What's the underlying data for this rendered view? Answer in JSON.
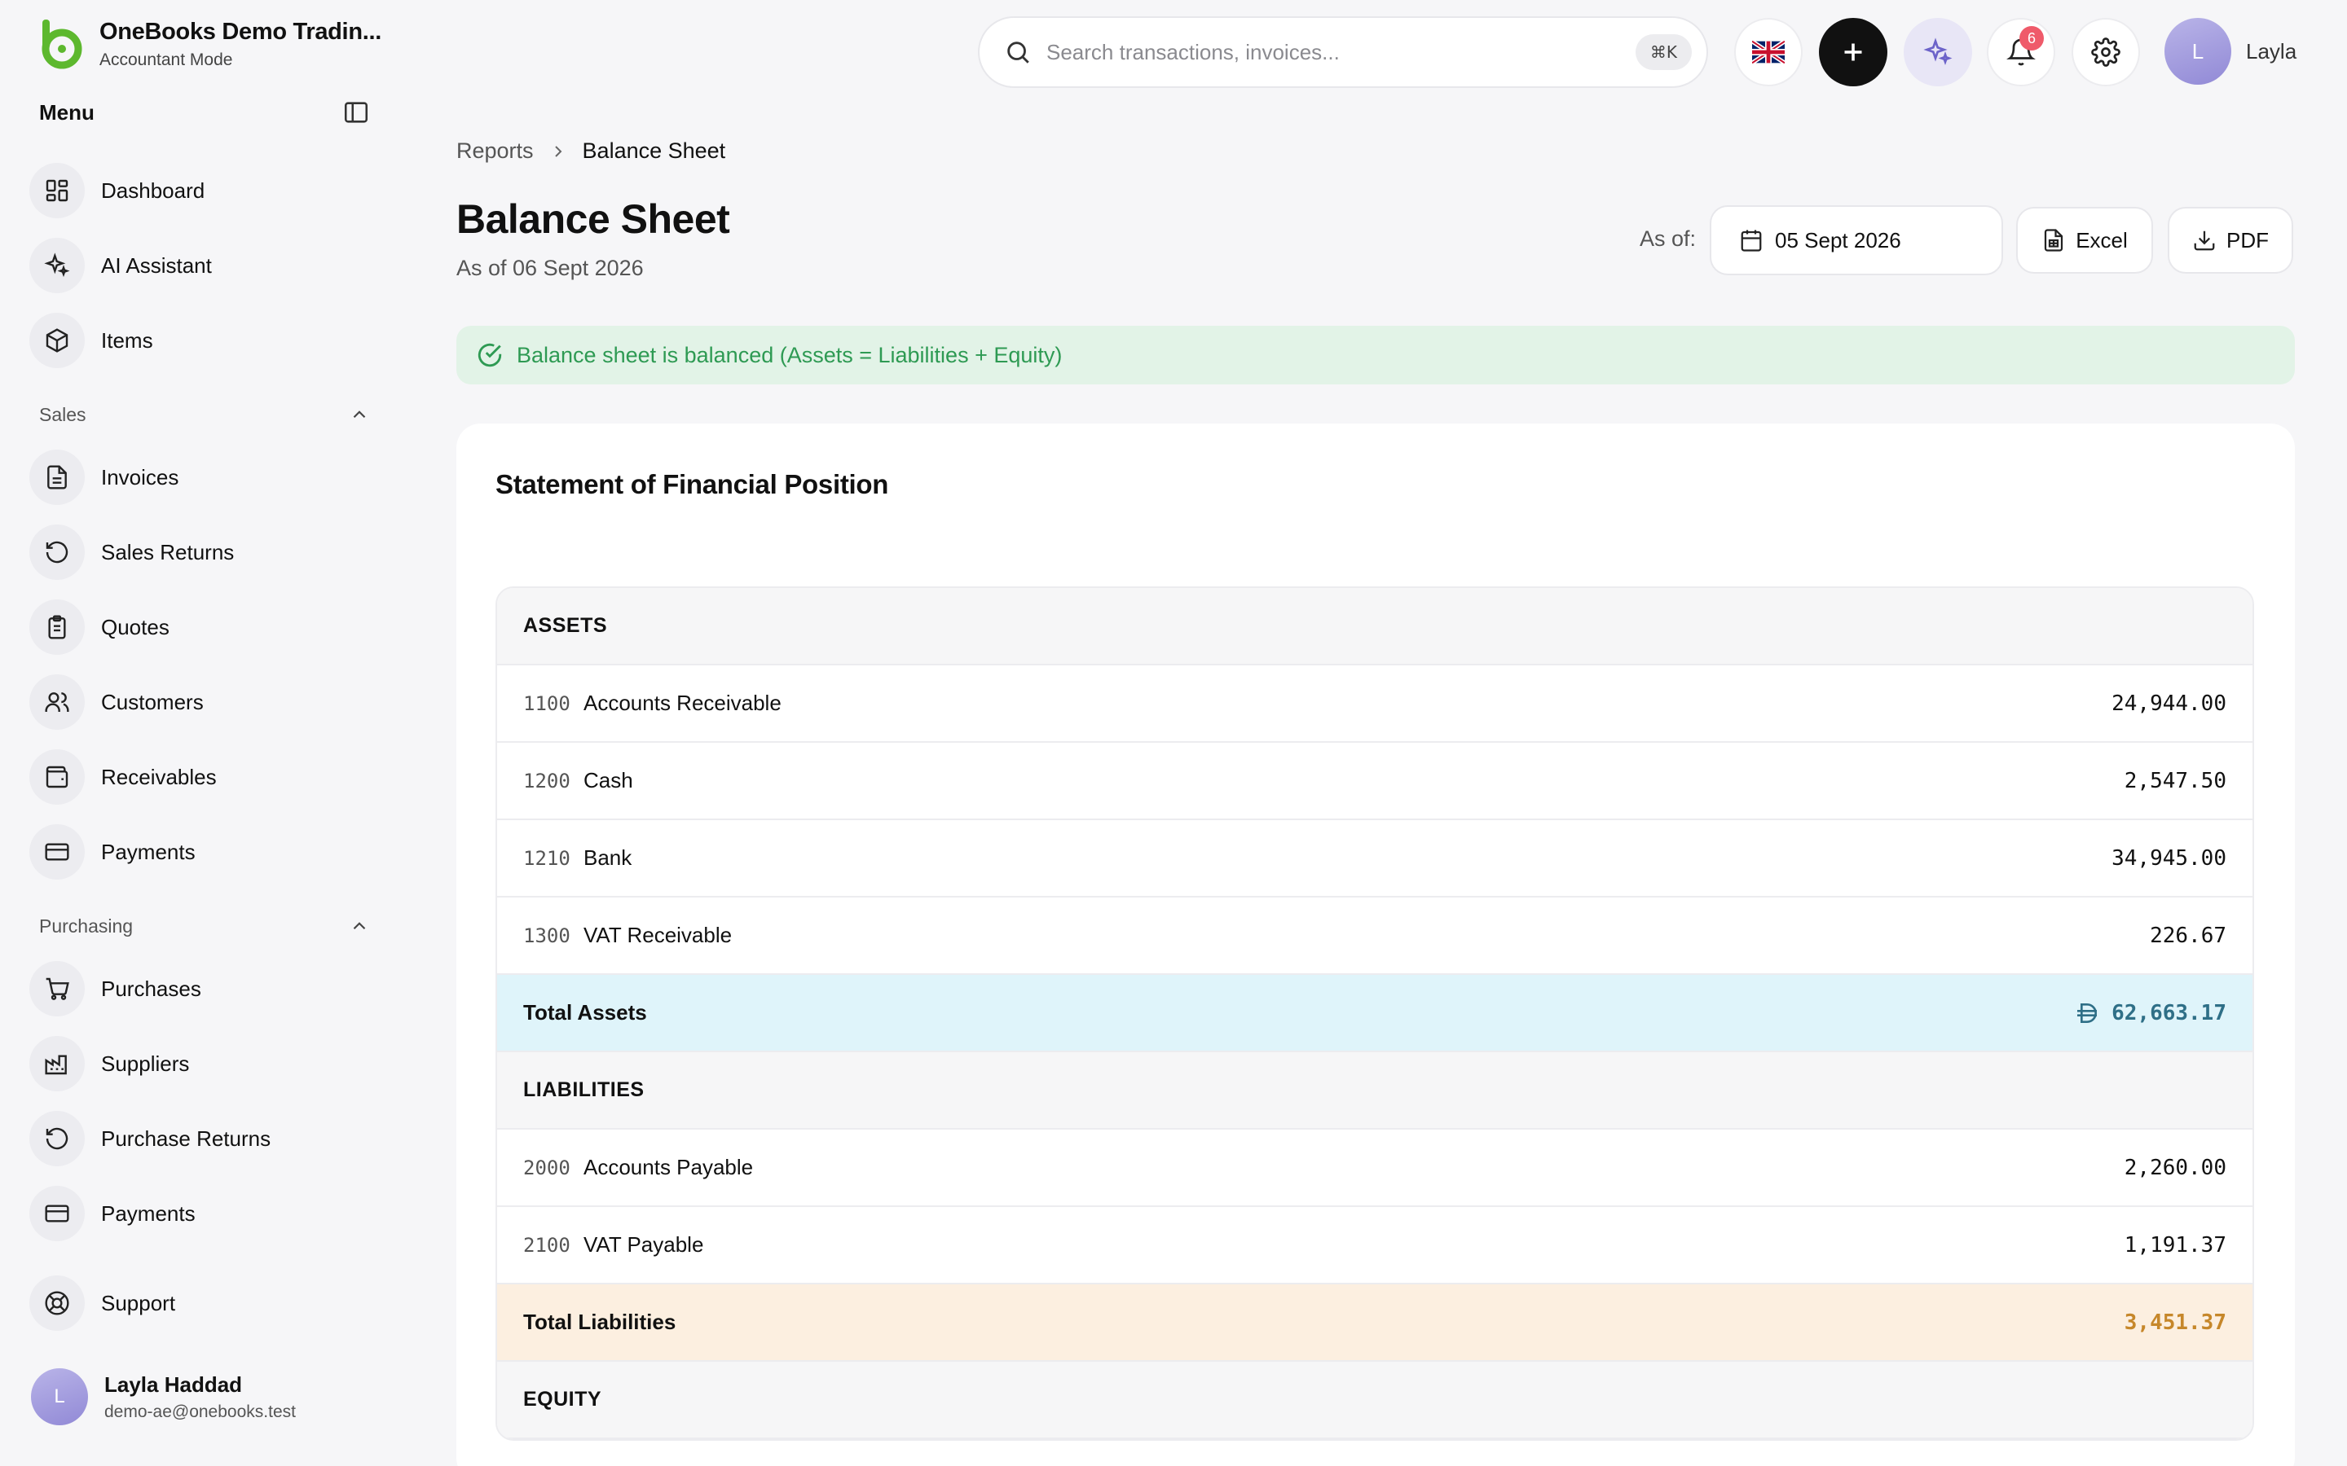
{
  "brand": {
    "title": "OneBooks Demo Tradin...",
    "subtitle": "Accountant Mode",
    "color": "#5db82e"
  },
  "sidebar": {
    "menu_label": "Menu",
    "items_top": [
      {
        "label": "Dashboard",
        "icon": "dashboard-icon"
      },
      {
        "label": "AI Assistant",
        "icon": "sparkles-icon"
      },
      {
        "label": "Items",
        "icon": "box-icon"
      }
    ],
    "sales": {
      "label": "Sales",
      "items": [
        {
          "label": "Invoices",
          "icon": "document-icon"
        },
        {
          "label": "Sales Returns",
          "icon": "rotate-ccw-icon"
        },
        {
          "label": "Quotes",
          "icon": "clipboard-icon"
        },
        {
          "label": "Customers",
          "icon": "users-icon"
        },
        {
          "label": "Receivables",
          "icon": "wallet-icon"
        },
        {
          "label": "Payments",
          "icon": "credit-card-icon"
        }
      ]
    },
    "purchasing": {
      "label": "Purchasing",
      "items": [
        {
          "label": "Purchases",
          "icon": "cart-icon"
        },
        {
          "label": "Suppliers",
          "icon": "factory-icon"
        },
        {
          "label": "Purchase Returns",
          "icon": "rotate-ccw-icon"
        },
        {
          "label": "Payments",
          "icon": "credit-card-icon"
        }
      ]
    },
    "support_label": "Support",
    "user": {
      "initial": "L",
      "name": "Layla Haddad",
      "email": "demo-ae@onebooks.test"
    }
  },
  "topbar": {
    "search_placeholder": "Search transactions, invoices...",
    "shortcut": "⌘K",
    "notification_count": "6",
    "user_initial": "L",
    "user_name": "Layla"
  },
  "breadcrumb": [
    "Reports",
    "Balance Sheet"
  ],
  "page": {
    "title": "Balance Sheet",
    "subtitle": "As of 06 Sept 2026",
    "as_of_label": "As of:",
    "date_value": "05 Sept 2026",
    "excel_label": "Excel",
    "pdf_label": "PDF"
  },
  "alert": {
    "text": "Balance sheet is balanced (Assets = Liabilities + Equity)",
    "color": "#2e9a53"
  },
  "statement": {
    "title": "Statement of Financial Position",
    "assets_header": "ASSETS",
    "assets": [
      {
        "code": "1100",
        "name": "Accounts Receivable",
        "amount": "24,944.00"
      },
      {
        "code": "1200",
        "name": "Cash",
        "amount": "2,547.50"
      },
      {
        "code": "1210",
        "name": "Bank",
        "amount": "34,945.00"
      },
      {
        "code": "1300",
        "name": "VAT Receivable",
        "amount": "226.67"
      }
    ],
    "total_assets": {
      "label": "Total Assets",
      "amount": "62,663.17",
      "currency_icon": "dirham-icon"
    },
    "liabilities_header": "LIABILITIES",
    "liabilities": [
      {
        "code": "2000",
        "name": "Accounts Payable",
        "amount": "2,260.00"
      },
      {
        "code": "2100",
        "name": "VAT Payable",
        "amount": "1,191.37"
      }
    ],
    "total_liabilities": {
      "label": "Total Liabilities",
      "amount": "3,451.37"
    },
    "equity_header": "EQUITY"
  }
}
